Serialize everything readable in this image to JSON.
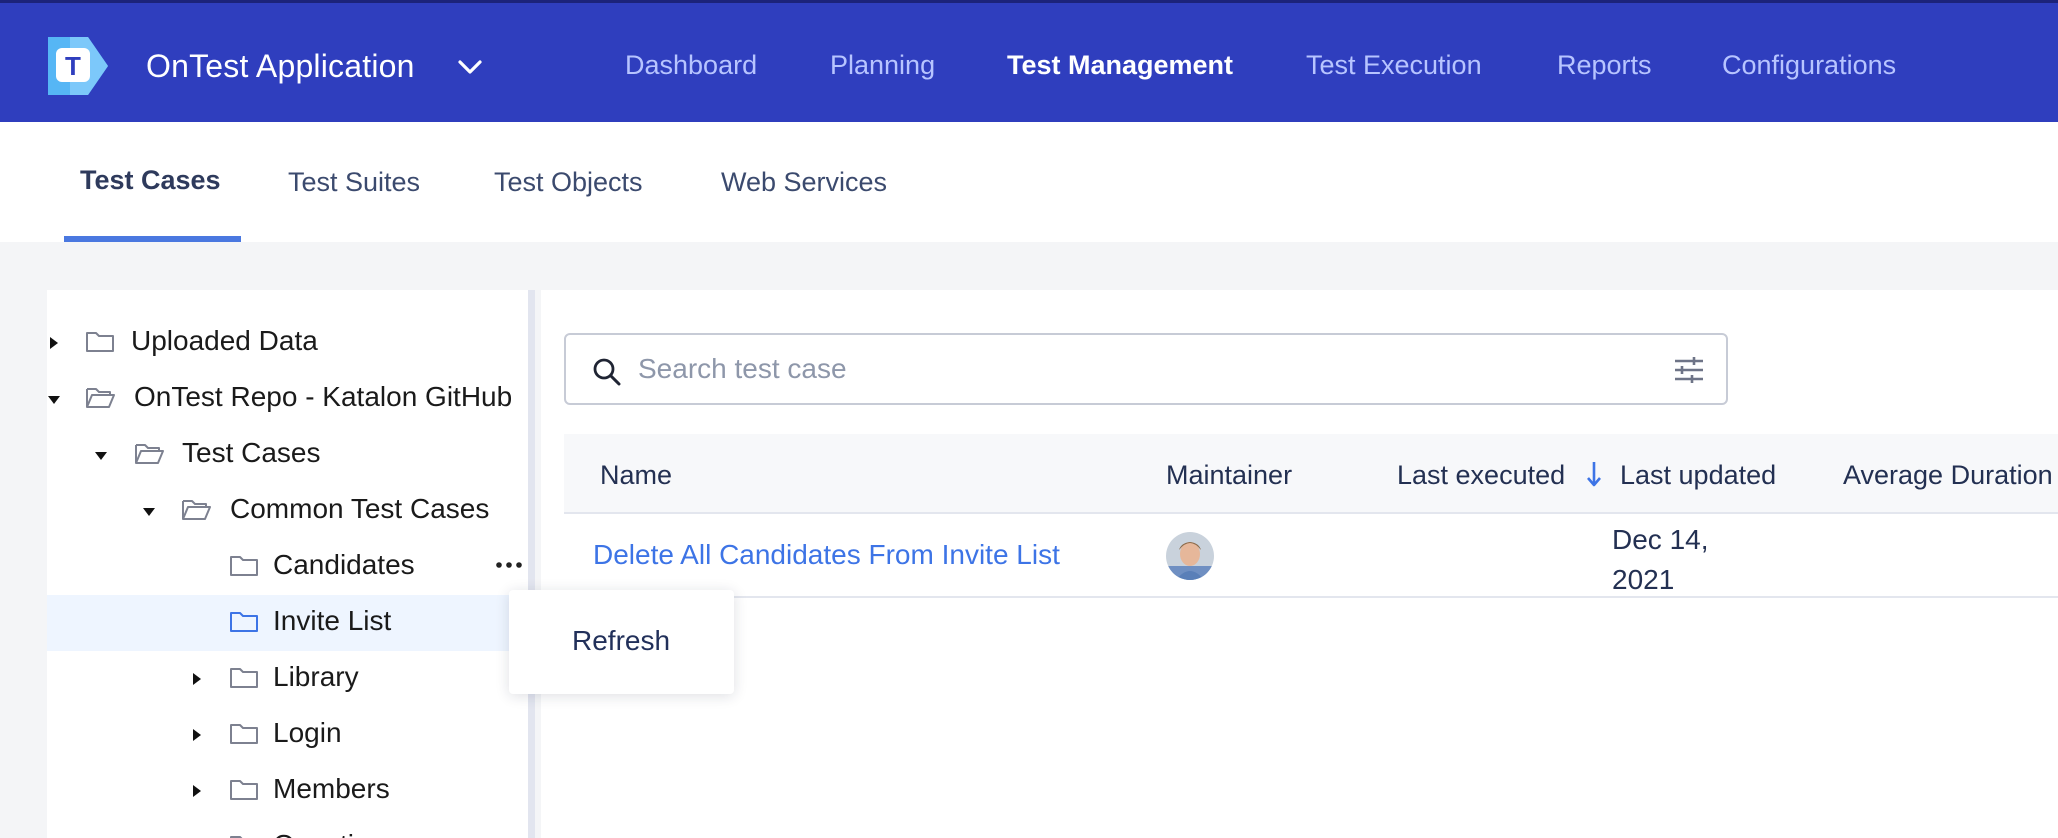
{
  "app": {
    "name": "OnTest Application",
    "brand_color": "#2f3ebe",
    "logo_letter": "T"
  },
  "nav": {
    "items": [
      {
        "label": "Dashboard",
        "active": false
      },
      {
        "label": "Planning",
        "active": false
      },
      {
        "label": "Test Management",
        "active": true
      },
      {
        "label": "Test Execution",
        "active": false
      },
      {
        "label": "Reports",
        "active": false
      },
      {
        "label": "Configurations",
        "active": false
      }
    ]
  },
  "subtabs": {
    "items": [
      {
        "label": "Test Cases",
        "active": true
      },
      {
        "label": "Test Suites",
        "active": false
      },
      {
        "label": "Test Objects",
        "active": false
      },
      {
        "label": "Web Services",
        "active": false
      }
    ],
    "accent": "#4a78e0"
  },
  "tree": {
    "items": [
      {
        "label": "Uploaded Data",
        "expanded": false,
        "icon": "folder-icon"
      },
      {
        "label": "OnTest Repo - Katalon GitHub",
        "expanded": true,
        "icon": "folder-open-icon"
      },
      {
        "label": "Test Cases",
        "expanded": true,
        "icon": "folder-open-icon"
      },
      {
        "label": "Common Test Cases",
        "expanded": true,
        "icon": "folder-open-icon"
      },
      {
        "label": "Candidates",
        "icon": "folder-icon"
      },
      {
        "label": "Invite List",
        "selected": true,
        "icon": "folder-icon"
      },
      {
        "label": "Library",
        "expanded": false,
        "icon": "folder-icon"
      },
      {
        "label": "Login",
        "expanded": false,
        "icon": "folder-icon"
      },
      {
        "label": "Members",
        "expanded": false,
        "icon": "folder-icon"
      },
      {
        "label": "Question",
        "expanded": false,
        "icon": "folder-icon"
      }
    ]
  },
  "context_menu": {
    "items": [
      {
        "label": "Refresh"
      }
    ]
  },
  "search": {
    "placeholder": "Search test case",
    "value": ""
  },
  "table": {
    "columns": [
      "Name",
      "Maintainer",
      "Last executed",
      "Last updated",
      "Average Duration"
    ],
    "sort": {
      "column": "Last executed",
      "direction": "descending"
    },
    "rows": [
      {
        "name": "Delete All Candidates From Invite List",
        "maintainer_avatar": "avatar",
        "last_executed": "",
        "last_updated": "Dec 14, 2021",
        "average_duration": ""
      }
    ]
  }
}
